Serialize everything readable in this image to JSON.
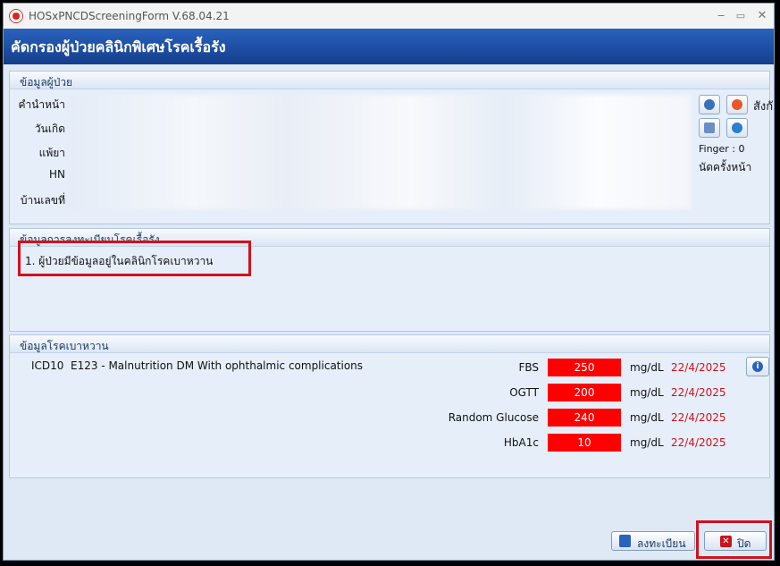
{
  "window": {
    "title": "HOSxPNCDScreeningForm V.68.04.21",
    "min_icon": "minimize-icon",
    "max_icon": "maximize-icon",
    "close_icon": "close-icon"
  },
  "header": {
    "title": "คัดกรองผู้ป่วยคลินิกพิเศษโรคเรื้อรัง"
  },
  "patient": {
    "section_title": "ข้อมูลผู้ป่วย",
    "labels": [
      "คำนำหน้า",
      "วันเกิด",
      "แพ้ยา",
      "HN",
      "บ้านเลขที่"
    ],
    "right_text": "สังกั",
    "finger": "Finger : 0",
    "next_appt": "นัดครั้งหน้า"
  },
  "registration": {
    "section_title": "ข้อมูลการลงทะเบียนโรคเรื้อรัง",
    "items": [
      "1. ผู้ป่วยมีข้อมูลอยู่ในคลินิกโรคเบาหวาน"
    ]
  },
  "diabetes": {
    "section_title": "ข้อมูลโรคเบาหวาน",
    "icd_label": "ICD10",
    "icd_value": "E123 - Malnutrition DM With ophthalmic complications",
    "labs": [
      {
        "name": "FBS",
        "value": "250",
        "unit": "mg/dL",
        "date": "22/4/2025"
      },
      {
        "name": "OGTT",
        "value": "200",
        "unit": "mg/dL",
        "date": "22/4/2025"
      },
      {
        "name": "Random Glucose",
        "value": "240",
        "unit": "mg/dL",
        "date": "22/4/2025"
      },
      {
        "name": "HbA1c",
        "value": "10",
        "unit": "mg/dL",
        "date": "22/4/2025"
      }
    ]
  },
  "buttons": {
    "register": "ลงทะเบียน",
    "close": "ปิด"
  },
  "colors": {
    "header": "#1d4f9f",
    "alert": "#ff0000",
    "highlight": "#d0121b"
  }
}
